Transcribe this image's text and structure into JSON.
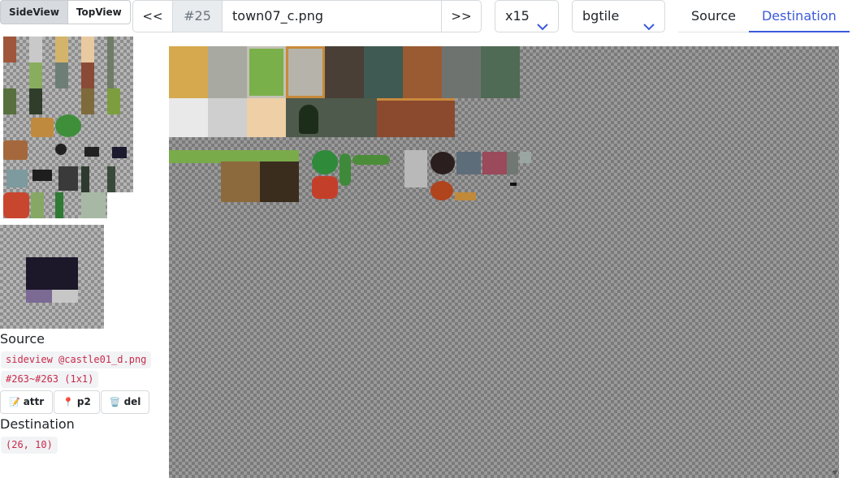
{
  "view_toggle": {
    "side_view": "SideView",
    "top_view": "TopView",
    "active": "SideView"
  },
  "navigation": {
    "prev": "<<",
    "index": "#25",
    "filename": "town07_c.png",
    "next": ">>"
  },
  "zoom_select": {
    "value": "x15"
  },
  "layer_select": {
    "value": "bgtile"
  },
  "tabs": {
    "source": "Source",
    "destination": "Destination",
    "active": "Destination"
  },
  "source_panel": {
    "title": "Source",
    "file": "sideview @castle01_d.png",
    "range": "#263~#263 (1x1)"
  },
  "actions": {
    "attr": "attr",
    "p2": "p2",
    "del": "del"
  },
  "destination_panel": {
    "title": "Destination",
    "coords": "(26, 10)"
  },
  "icons": {
    "chevron_down": "chevron-down-icon",
    "memo": "memo-icon",
    "pin": "pin-icon",
    "trash": "trash-icon"
  },
  "colors": {
    "accent": "#3b5bdb",
    "code": "#c92a4a",
    "grass": "#7aa84a",
    "stone": "#707a74"
  }
}
